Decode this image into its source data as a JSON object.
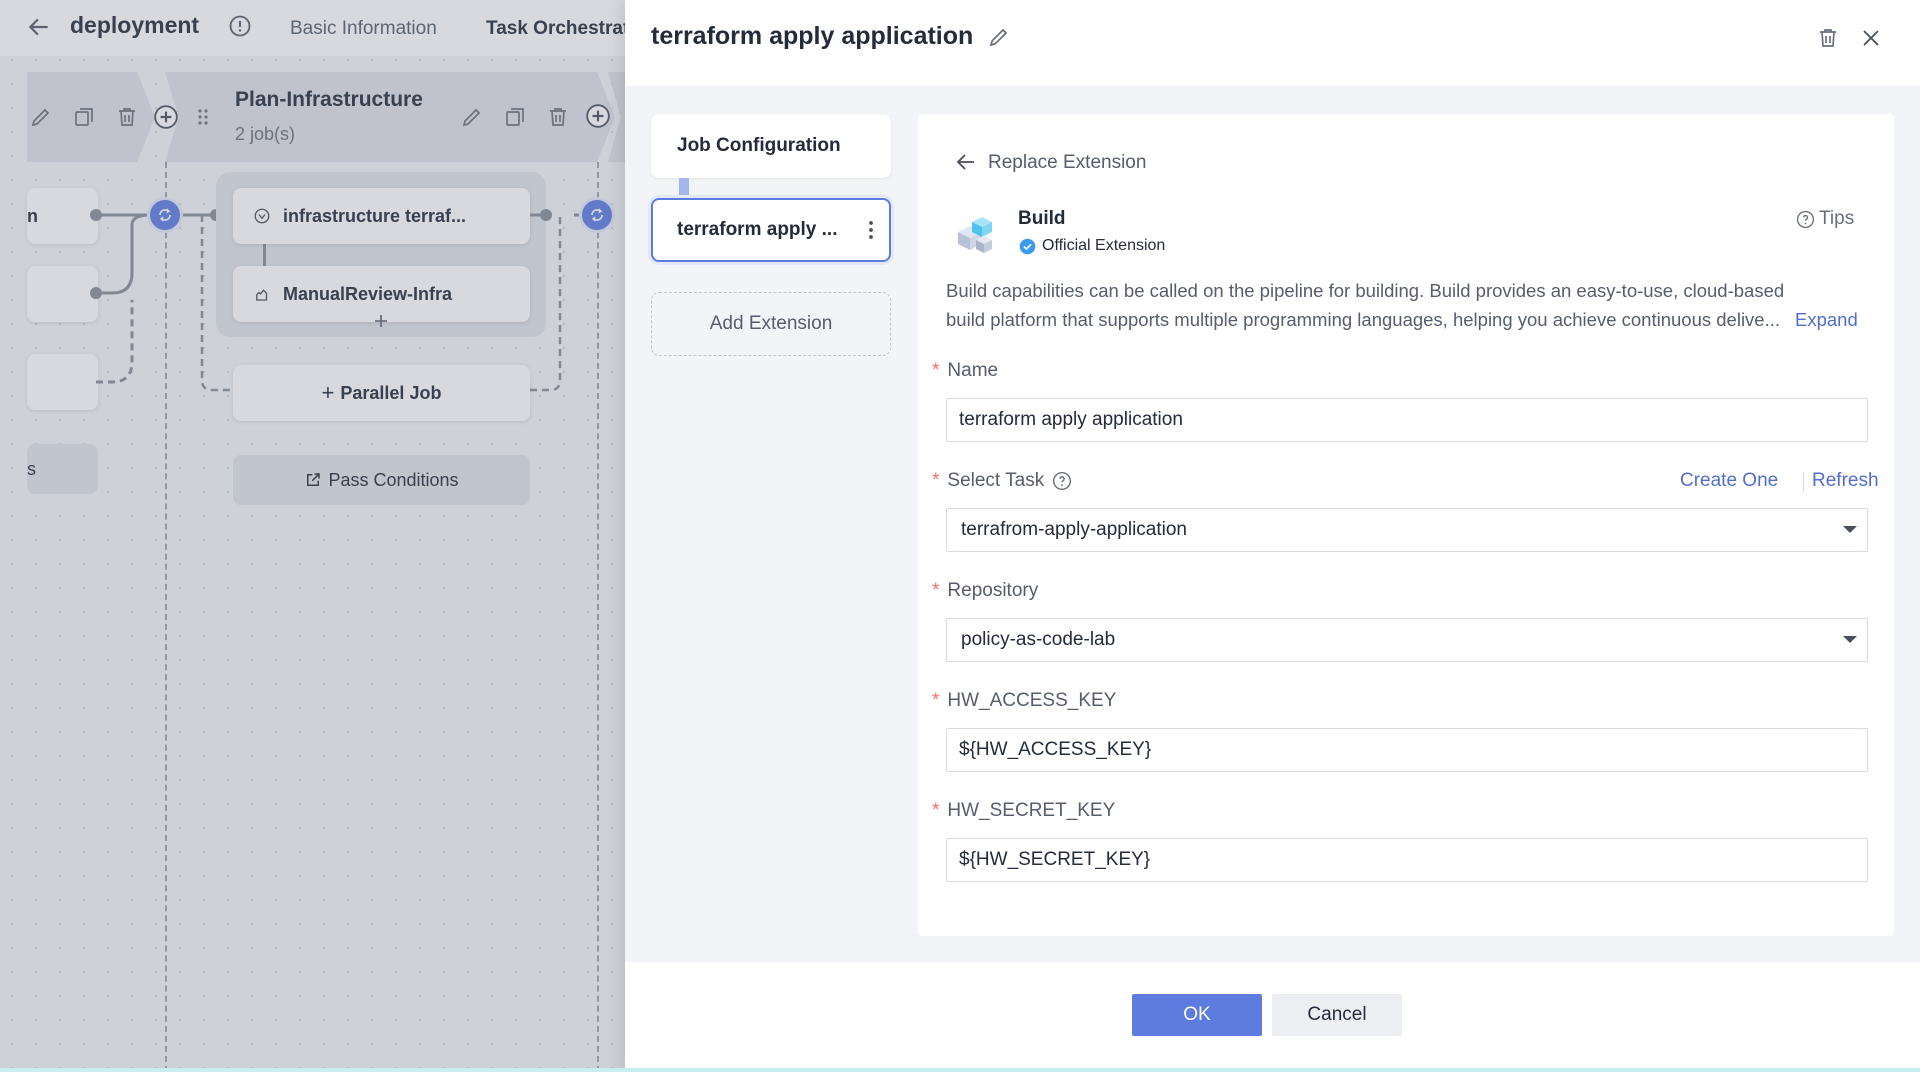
{
  "header": {
    "title": "deployment",
    "tabs": [
      "Basic Information",
      "Task Orchestrat"
    ]
  },
  "stage": {
    "name": "Plan-Infrastructure",
    "jobs_count": "2 job(s)"
  },
  "canvas": {
    "left_cards": [
      "n",
      "",
      "",
      "s"
    ],
    "job_cards": [
      "infrastructure terraf...",
      "ManualReview-Infra"
    ],
    "parallel_job": "Parallel Job",
    "pass_conditions": "Pass Conditions"
  },
  "drawer": {
    "title": "terraform apply application",
    "nav": {
      "job_config": "Job Configuration",
      "active_item": "terraform apply ...",
      "add_extension": "Add Extension"
    },
    "replace_extension": "Replace Extension",
    "extension": {
      "name": "Build",
      "badge": "Official Extension",
      "tips": "Tips",
      "description_line1": "Build capabilities can be called on the pipeline for building. Build provides an easy-to-use, cloud-based",
      "description_line2": "build platform that supports multiple programming languages, helping you achieve continuous delive...",
      "expand": "Expand"
    },
    "form": {
      "name_label": "Name",
      "name_value": "terraform apply application",
      "task_label": "Select Task",
      "task_value": "terrafrom-apply-application",
      "create_one": "Create One",
      "refresh": "Refresh",
      "repo_label": "Repository",
      "repo_value": "policy-as-code-lab",
      "ak_label": "HW_ACCESS_KEY",
      "ak_value": "${HW_ACCESS_KEY}",
      "sk_label": "HW_SECRET_KEY",
      "sk_value": "${HW_SECRET_KEY}"
    },
    "footer": {
      "ok": "OK",
      "cancel": "Cancel"
    }
  },
  "colors": {
    "primary": "#5e7ce0",
    "link": "#526ecc",
    "required": "#f66f6a",
    "background": "#f3f4f7"
  }
}
